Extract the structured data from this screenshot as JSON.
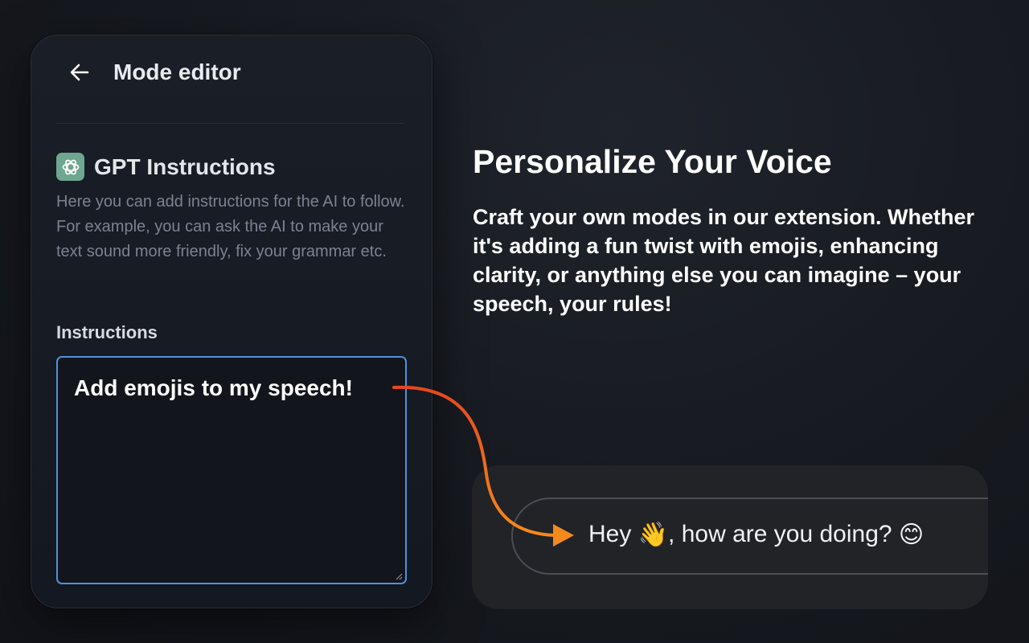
{
  "editor": {
    "title": "Mode editor",
    "section_title": "GPT Instructions",
    "section_description": "Here you can add instructions for the AI to follow. For example, you can ask the AI to make your text sound more friendly, fix your grammar etc.",
    "field_label": "Instructions",
    "field_value": "Add emojis to my speech!"
  },
  "promo": {
    "headline": "Personalize Your Voice",
    "body": "Craft your own modes in our extension. Whether it's adding a fun twist with emojis, enhancing clarity, or anything else you can imagine – your speech, your rules!"
  },
  "output": {
    "text_before": "Hey ",
    "emoji_wave": "👋",
    "text_middle": ", how are you doing? ",
    "emoji_smile": "😊"
  },
  "colors": {
    "accent_blue": "#4d93d9",
    "arrow_start": "#e8471d",
    "arrow_end": "#f58a1c",
    "gpt_icon_bg": "#6fa690"
  },
  "icons": {
    "back": "arrow-left-icon",
    "gpt": "openai-logo-icon"
  }
}
